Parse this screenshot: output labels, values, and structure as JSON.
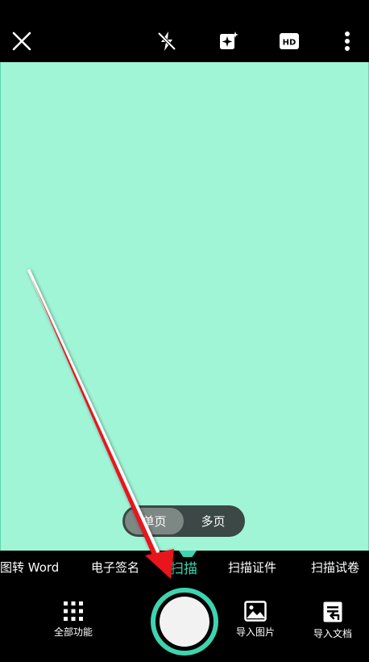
{
  "topbar": {
    "close_icon": "close-icon",
    "flash_icon": "flash-off-icon",
    "enhance_icon": "sparkle-icon",
    "hd_icon": "hd-icon",
    "hd_text": "HD",
    "more_icon": "more-vertical-icon"
  },
  "page_toggle": {
    "single_label": "单页",
    "multi_label": "多页",
    "selected": "单页"
  },
  "modes": {
    "items": [
      "图转 Word",
      "电子签名",
      "扫描",
      "扫描证件",
      "扫描试卷"
    ],
    "active": "扫描"
  },
  "bottom": {
    "all_functions_label": "全部功能",
    "import_image_label": "导入图片",
    "import_doc_label": "导入文档"
  },
  "colors": {
    "accent": "#3fd3b0",
    "preview_bg": "#a0f5d7",
    "arrow": "#e8141c"
  }
}
